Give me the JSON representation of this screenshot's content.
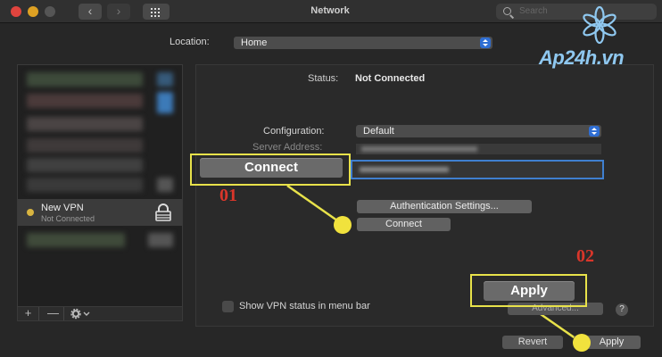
{
  "window": {
    "title": "Network"
  },
  "search": {
    "placeholder": "Search"
  },
  "location": {
    "label": "Location:",
    "value": "Home"
  },
  "sidebar": {
    "vpn_item": {
      "name": "New VPN",
      "status": "Not Connected"
    },
    "footer": {
      "add": "+",
      "remove": "—"
    }
  },
  "detail": {
    "status_label": "Status:",
    "status_value": "Not Connected",
    "configuration_label": "Configuration:",
    "configuration_value": "Default",
    "server_address_label": "Server Address:",
    "authentication_settings_label": "Authentication Settings...",
    "connect_label": "Connect",
    "show_vpn_status_label": "Show VPN status in menu bar",
    "advanced_label": "Advanced...",
    "help_label": "?"
  },
  "footer": {
    "revert_label": "Revert",
    "apply_label": "Apply"
  },
  "annotations": {
    "marker_1": "01",
    "marker_2": "02",
    "connect_callout": "Connect",
    "apply_callout": "Apply",
    "highlight_color": "#e8e24a",
    "marker_color": "#d9362a"
  },
  "logo": {
    "text": "Ap24h.vn"
  }
}
